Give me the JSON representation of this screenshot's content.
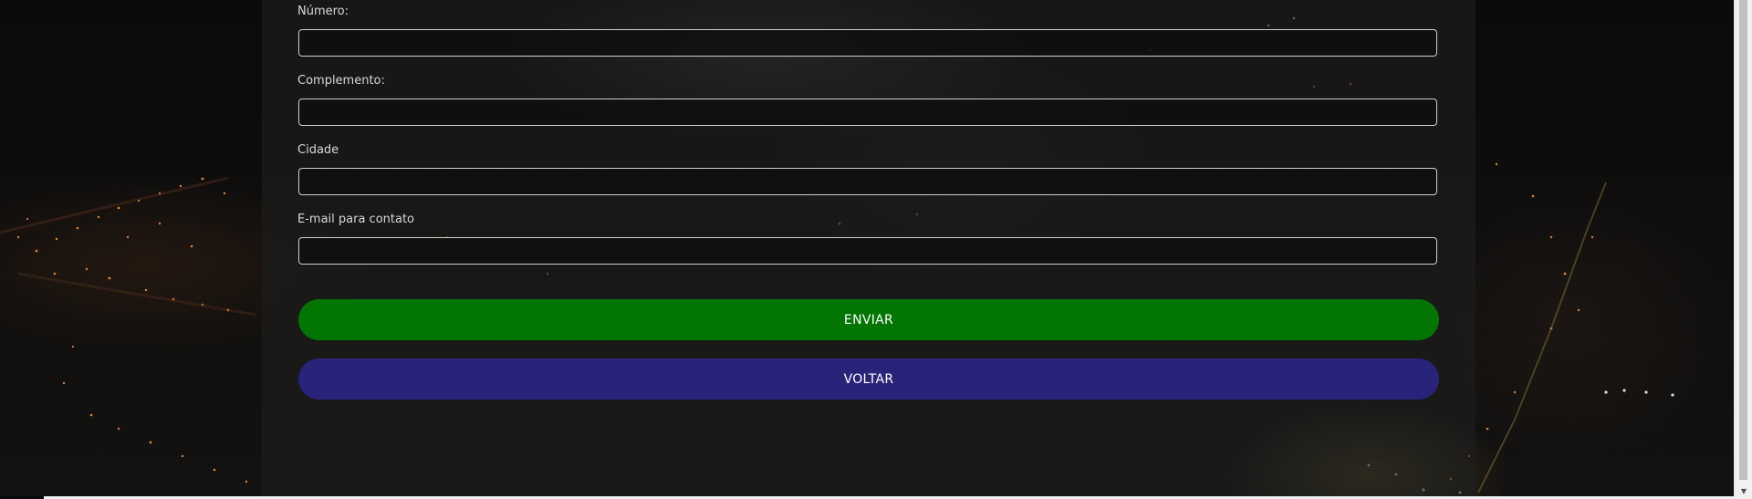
{
  "form": {
    "fields": [
      {
        "label": "Número:",
        "value": ""
      },
      {
        "label": "Complemento:",
        "value": ""
      },
      {
        "label": "Cidade",
        "value": ""
      },
      {
        "label": "E-mail para contato",
        "value": ""
      }
    ],
    "submit_label": "ENVIAR",
    "back_label": "VOLTAR"
  },
  "colors": {
    "submit_button": "#037503",
    "back_button": "#29237a",
    "field_border": "#cfcfcf",
    "label_text": "#d8d8d8"
  }
}
